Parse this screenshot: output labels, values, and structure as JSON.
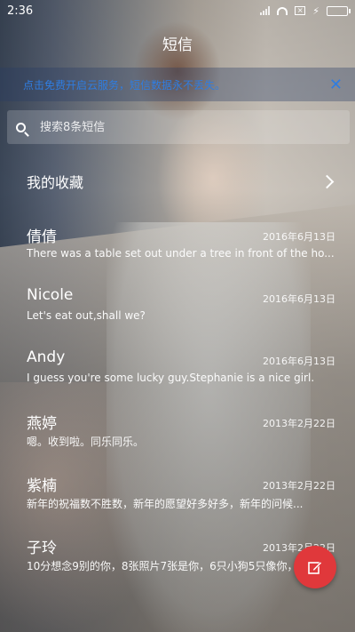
{
  "status_bar": {
    "time": "2:36"
  },
  "header": {
    "title": "短信"
  },
  "notice": {
    "text": "点击免费开启云服务，短信数据永不丢失。"
  },
  "search": {
    "placeholder": "搜索8条短信"
  },
  "favorites": {
    "label": "我的收藏"
  },
  "messages": [
    {
      "name": "倩倩",
      "date": "2016年6月13日",
      "preview": "There was a table set out under a tree in front of the ho..."
    },
    {
      "name": "Nicole",
      "date": "2016年6月13日",
      "preview": "Let's eat out,shall we?"
    },
    {
      "name": "Andy",
      "date": "2016年6月13日",
      "preview": "I guess you're some lucky guy.Stephanie is a nice girl."
    },
    {
      "name": "燕婷",
      "date": "2013年2月22日",
      "preview": "嗯。收到啦。同乐同乐。"
    },
    {
      "name": "紫楠",
      "date": "2013年2月22日",
      "preview": "新年的祝福数不胜数，新年的愿望好多好多，新年的问候..."
    },
    {
      "name": "子玲",
      "date": "2013年2月22日",
      "preview": "10分想念9别的你，8张照片7张是你，6只小狗5只像你，4..."
    }
  ],
  "colors": {
    "notice_text": "#2f7de1",
    "fab": "#e0383b",
    "battery": "#4cd964"
  },
  "icons": {
    "fab": "compose-icon",
    "search": "search-icon",
    "favorites": "chevron-right-icon",
    "notice_close": "close-icon"
  }
}
